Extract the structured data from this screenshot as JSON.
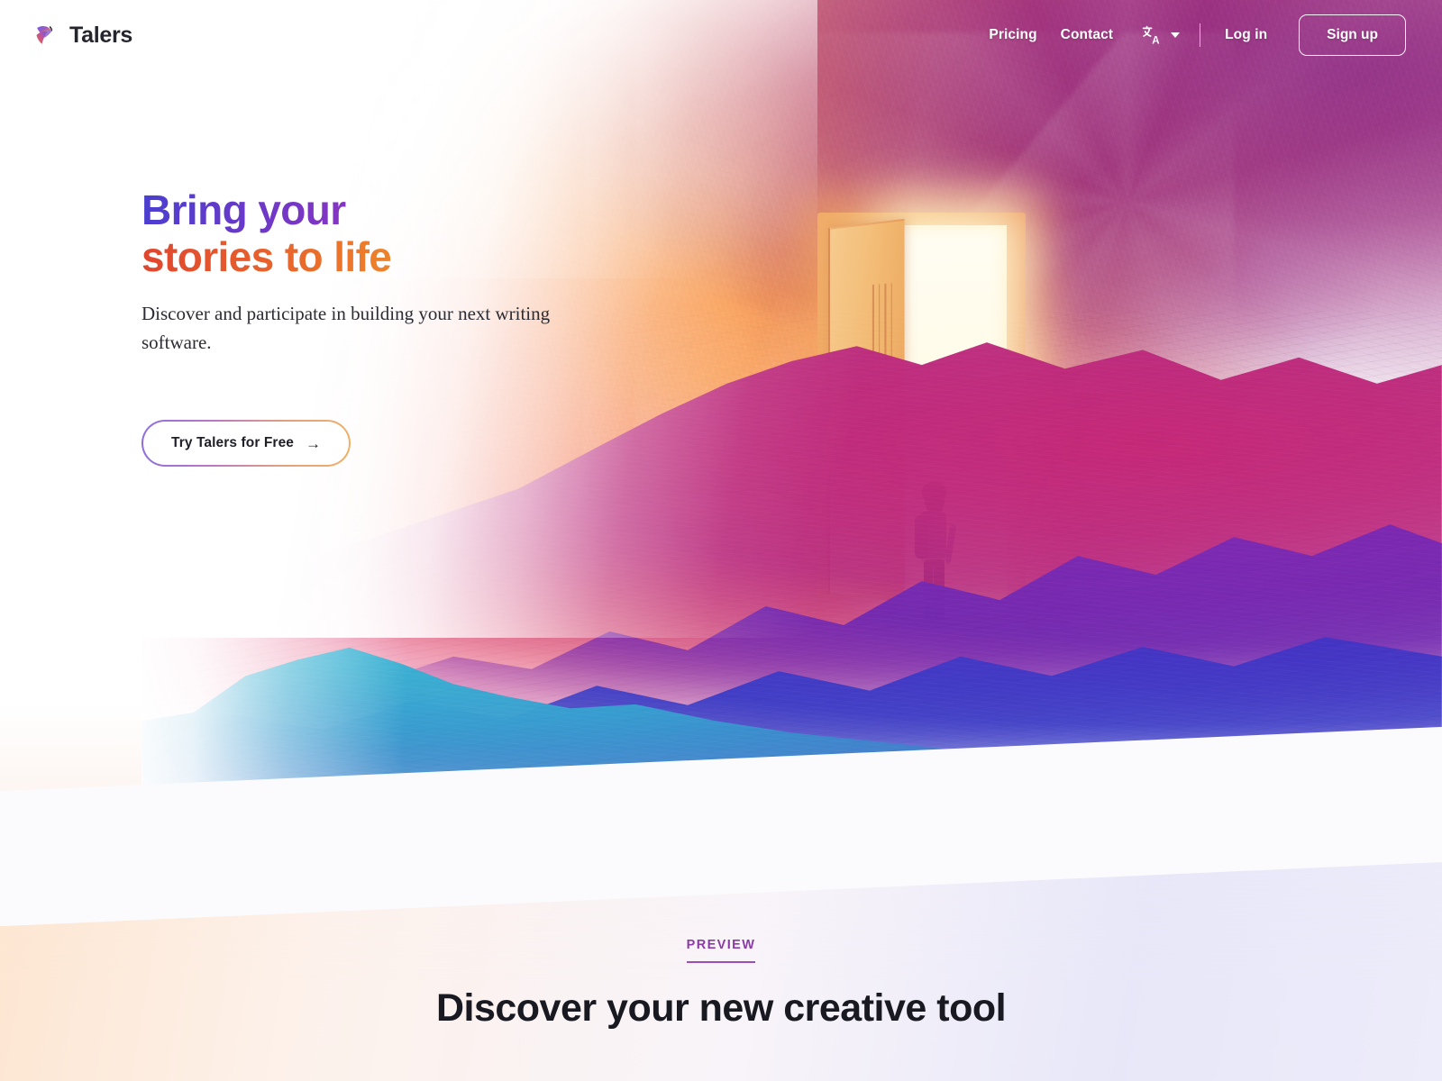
{
  "brand": {
    "name": "Talers",
    "logo_icon": "butterfly-logo-icon"
  },
  "nav": {
    "links": [
      {
        "label": "Pricing"
      },
      {
        "label": "Contact"
      }
    ],
    "language_selector": {
      "icon": "translate-icon",
      "caret_icon": "chevron-down-icon"
    },
    "login_label": "Log in",
    "signup_label": "Sign up"
  },
  "hero": {
    "title_line1": "Bring your",
    "title_line2": "stories to life",
    "subtitle": "Discover and participate in building your next writing software.",
    "cta_label": "Try Talers for Free",
    "cta_arrow": "→",
    "artwork_alt": "child-at-glowing-door-illustration"
  },
  "preview": {
    "eyebrow": "PREVIEW",
    "title": "Discover your new creative tool"
  },
  "colors": {
    "accent_purple": "#8b3ba7",
    "accent_underline": "#9b4fb5",
    "heading_dark": "#191921",
    "title_gradient_start": "#4b3fd0",
    "title_gradient_mid": "#9b34b6",
    "title_gradient_end": "#3f52da",
    "title2_gradient_start": "#e0452f",
    "title2_gradient_end": "#eeb13c",
    "nav_text": "#ffffff",
    "body_text": "#2c2c34"
  }
}
